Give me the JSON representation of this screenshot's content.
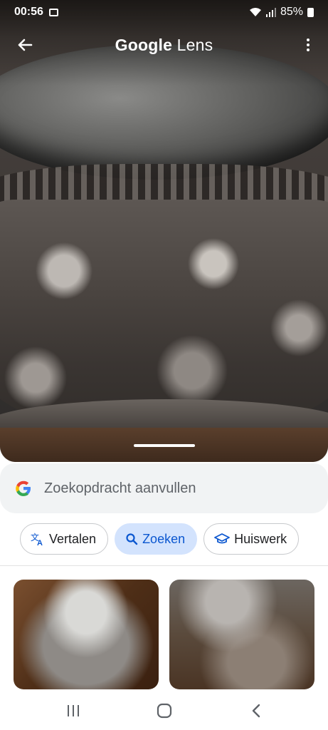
{
  "status_bar": {
    "time": "00:56",
    "battery": "85%",
    "icons": [
      "image-icon",
      "wifi-icon",
      "signal-icon",
      "battery-icon"
    ]
  },
  "app_bar": {
    "title_part1": "Google",
    "title_part2": "Lens",
    "back_icon": "arrow-left-icon",
    "menu_icon": "more-vertical-icon"
  },
  "search": {
    "placeholder": "Zoekopdracht aanvullen",
    "icon": "google-g-icon"
  },
  "chips": [
    {
      "label": "Vertalen",
      "icon": "translate-icon",
      "active": false
    },
    {
      "label": "Zoeken",
      "icon": "search-icon",
      "active": true
    },
    {
      "label": "Huiswerk",
      "icon": "graduation-cap-icon",
      "active": false
    }
  ],
  "colors": {
    "accent": "#0b57d0",
    "active_chip_bg": "#d3e3fd",
    "search_bg": "#f1f3f4"
  },
  "navigation": {
    "buttons": [
      "recents-icon",
      "home-icon",
      "back-icon"
    ]
  }
}
